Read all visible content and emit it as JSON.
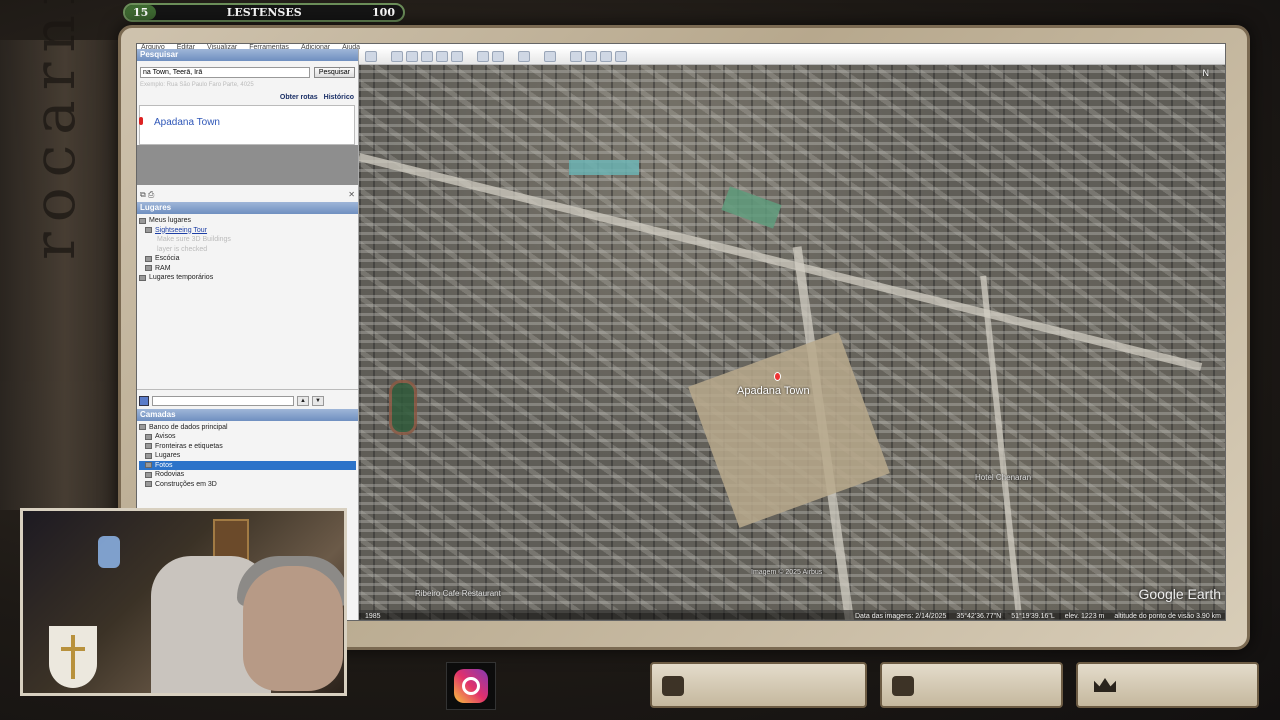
{
  "overlay": {
    "side_word": "rocarni",
    "top_bar": {
      "level": "15",
      "name": "LESTENSES",
      "score": "100"
    }
  },
  "app": {
    "menu": [
      "Arquivo",
      "Editar",
      "Visualizar",
      "Ferramentas",
      "Adicionar",
      "Ajuda"
    ],
    "search": {
      "header": "Pesquisar",
      "query": "na Town, Teerã, Irã",
      "button": "Pesquisar",
      "hint": "Exemplo: Rua São Paulo Faro Parte, 4025",
      "links": [
        "Obter rotas",
        "Histórico"
      ],
      "result": "Apadana Town"
    },
    "places": {
      "header": "Lugares",
      "items": [
        {
          "label": "Meus lugares",
          "style": "normal"
        },
        {
          "label": "Sightseeing Tour",
          "style": "link"
        },
        {
          "label": "Make sure 3D Buildings",
          "style": "faded"
        },
        {
          "label": "layer is checked",
          "style": "faded"
        },
        {
          "label": "Escócia",
          "style": "normal"
        },
        {
          "label": "RAM",
          "style": "normal"
        },
        {
          "label": "Lugares temporários",
          "style": "normal"
        }
      ]
    },
    "layers": {
      "header": "Camadas",
      "items": [
        {
          "label": "Banco de dados principal",
          "selected": false
        },
        {
          "label": "Avisos",
          "selected": false
        },
        {
          "label": "Fronteiras e etiquetas",
          "selected": false
        },
        {
          "label": "Lugares",
          "selected": false
        },
        {
          "label": "Fotos",
          "selected": true
        },
        {
          "label": "Rodovias",
          "selected": false
        },
        {
          "label": "Construções em 3D",
          "selected": false
        }
      ]
    },
    "map": {
      "place_label": "Apadana Town",
      "secondary_label": "Hotel Chenaran",
      "bottom_label": "Ribeiro Cafe Restaurant",
      "copyright": "Imagem © 2025 Airbus",
      "logo": "Google Earth",
      "compass": "N",
      "status": {
        "year": "1985",
        "imagery_date": "Data das imagens: 2/14/2025",
        "lat": "35°42'36.77\"N",
        "lon": "51°19'39.16\"L",
        "elev": "elev. 1223 m",
        "eye_alt": "altitude do ponto de visão   3.90 km"
      }
    }
  }
}
